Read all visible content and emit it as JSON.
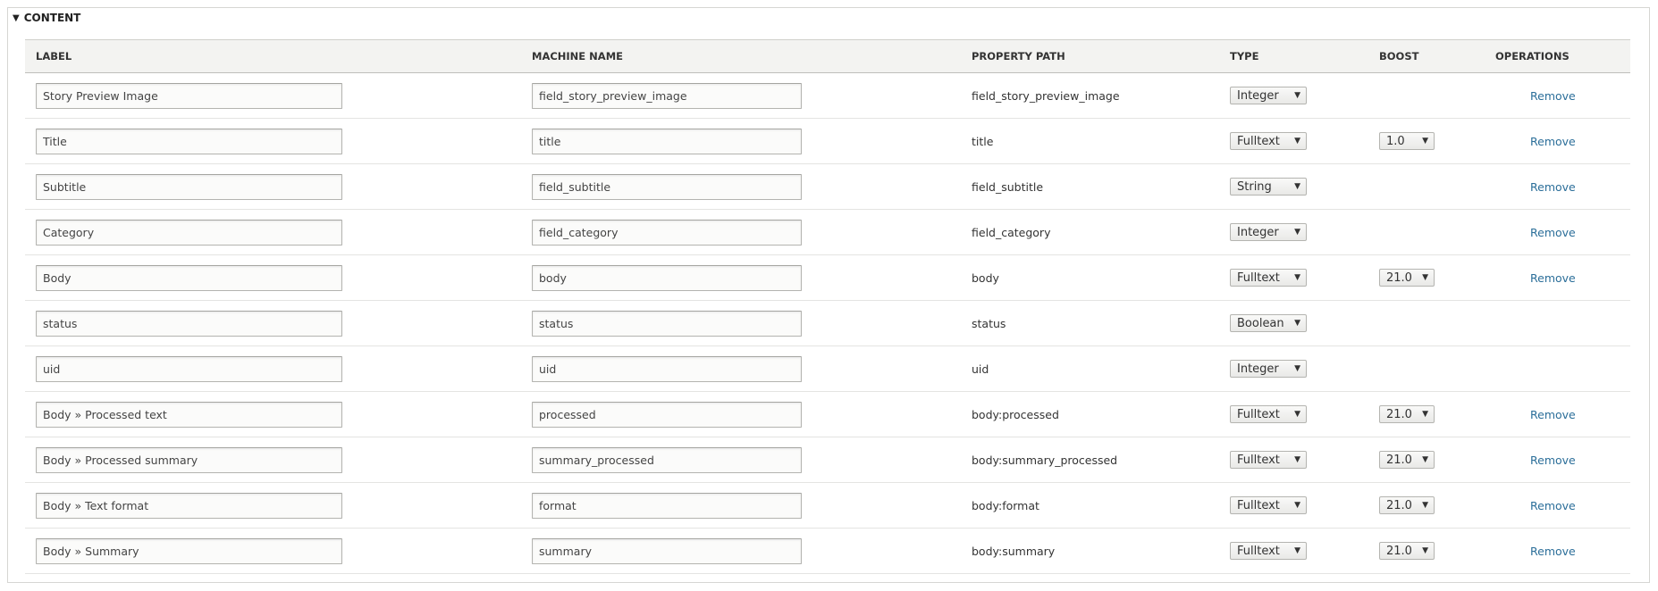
{
  "section": {
    "title": "CONTENT",
    "toggle_icon": "triangle-down"
  },
  "columns": {
    "label": "LABEL",
    "machine_name": "MACHINE NAME",
    "property_path": "PROPERTY PATH",
    "type": "TYPE",
    "boost": "BOOST",
    "operations": "OPERATIONS"
  },
  "rows": [
    {
      "label": "Story Preview Image",
      "machine_name": "field_story_preview_image",
      "property_path": "field_story_preview_image",
      "type": "Integer",
      "boost": null,
      "operation": "Remove"
    },
    {
      "label": "Title",
      "machine_name": "title",
      "property_path": "title",
      "type": "Fulltext",
      "boost": "1.0",
      "operation": "Remove"
    },
    {
      "label": "Subtitle",
      "machine_name": "field_subtitle",
      "property_path": "field_subtitle",
      "type": "String",
      "boost": null,
      "operation": "Remove"
    },
    {
      "label": "Category",
      "machine_name": "field_category",
      "property_path": "field_category",
      "type": "Integer",
      "boost": null,
      "operation": "Remove"
    },
    {
      "label": "Body",
      "machine_name": "body",
      "property_path": "body",
      "type": "Fulltext",
      "boost": "21.0",
      "operation": "Remove"
    },
    {
      "label": "status",
      "machine_name": "status",
      "property_path": "status",
      "type": "Boolean",
      "boost": null,
      "operation": null
    },
    {
      "label": "uid",
      "machine_name": "uid",
      "property_path": "uid",
      "type": "Integer",
      "boost": null,
      "operation": null
    },
    {
      "label": "Body » Processed text",
      "machine_name": "processed",
      "property_path": "body:processed",
      "type": "Fulltext",
      "boost": "21.0",
      "operation": "Remove"
    },
    {
      "label": "Body » Processed summary",
      "machine_name": "summary_processed",
      "property_path": "body:summary_processed",
      "type": "Fulltext",
      "boost": "21.0",
      "operation": "Remove"
    },
    {
      "label": "Body » Text format",
      "machine_name": "format",
      "property_path": "body:format",
      "type": "Fulltext",
      "boost": "21.0",
      "operation": "Remove"
    },
    {
      "label": "Body » Summary",
      "machine_name": "summary",
      "property_path": "body:summary",
      "type": "Fulltext",
      "boost": "21.0",
      "operation": "Remove"
    }
  ],
  "colors": {
    "link": "#2b6e99",
    "header_bg": "#f3f3f1",
    "border": "#d6d6d3"
  }
}
